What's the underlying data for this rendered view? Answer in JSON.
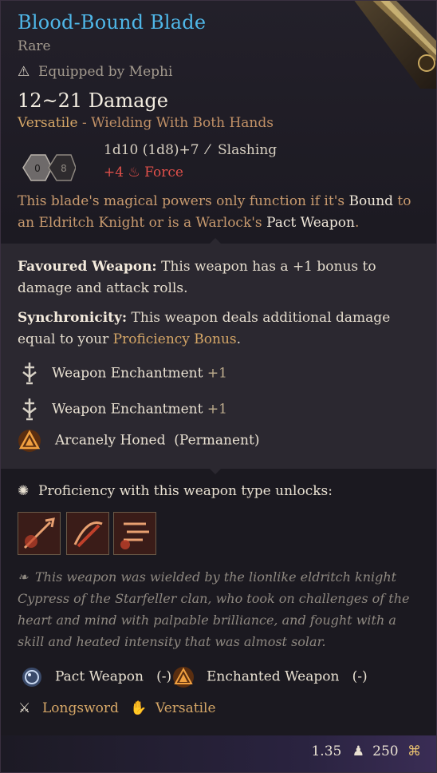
{
  "item": {
    "name": "Blood-Bound Blade",
    "rarity": "Rare",
    "equipped_by": "Equipped by Mephi",
    "damage": "12~21 Damage",
    "versatile_label": "Versatile",
    "versatile_note": "- Wielding With Both Hands",
    "roll": "1d10 (1d8)+7",
    "roll_type": "Slashing",
    "force_bonus": "+4",
    "force_label": "Force",
    "dice_values": [
      "0",
      "8"
    ],
    "desc_pre": "This blade's magical powers only function if it's ",
    "desc_bound": "Bound",
    "desc_mid": " to an Eldritch Knight or is a Warlock's ",
    "desc_pact": "Pact Weapon",
    "desc_end": "."
  },
  "properties": {
    "favoured_title": "Favoured Weapon:",
    "favoured_text": " This weapon has a +1 bonus to damage and attack rolls.",
    "sync_title": "Synchronicity:",
    "sync_text": " This weapon deals additional damage equal to your ",
    "sync_link": "Proficiency Bonus",
    "sync_end": ".",
    "enchantments": [
      {
        "label": "Weapon Enchantment",
        "bonus": "+1",
        "icon": "sword-enchant-icon"
      },
      {
        "label": "Weapon Enchantment",
        "bonus": "+1",
        "icon": "sword-enchant-icon"
      }
    ],
    "honed": "Arcanely Honed",
    "honed_note": "(Permanent)"
  },
  "proficiency": {
    "unlock_label": "Proficiency with this weapon type unlocks:",
    "actions": [
      "lunging-attack-icon",
      "slashing-attack-icon",
      "rush-attack-icon"
    ]
  },
  "lore": "This weapon was wielded by the lionlike eldritch knight Cypress of the Starfeller clan, who took on challenges of the heart and mind with palpable brilliance, and fought with a skill and heated intensity that was almost solar.",
  "tags": {
    "pact": "Pact Weapon",
    "pact_note": "(-)",
    "enchanted": "Enchanted Weapon",
    "enchanted_note": "(-)",
    "type": "Longsword",
    "versatile": "Versatile"
  },
  "footer": {
    "weight": "1.35",
    "value": "250"
  },
  "colors": {
    "title": "#4fb7e8",
    "rare": "#a39a8e",
    "force": "#e0504a",
    "gold": "#d6a767"
  }
}
